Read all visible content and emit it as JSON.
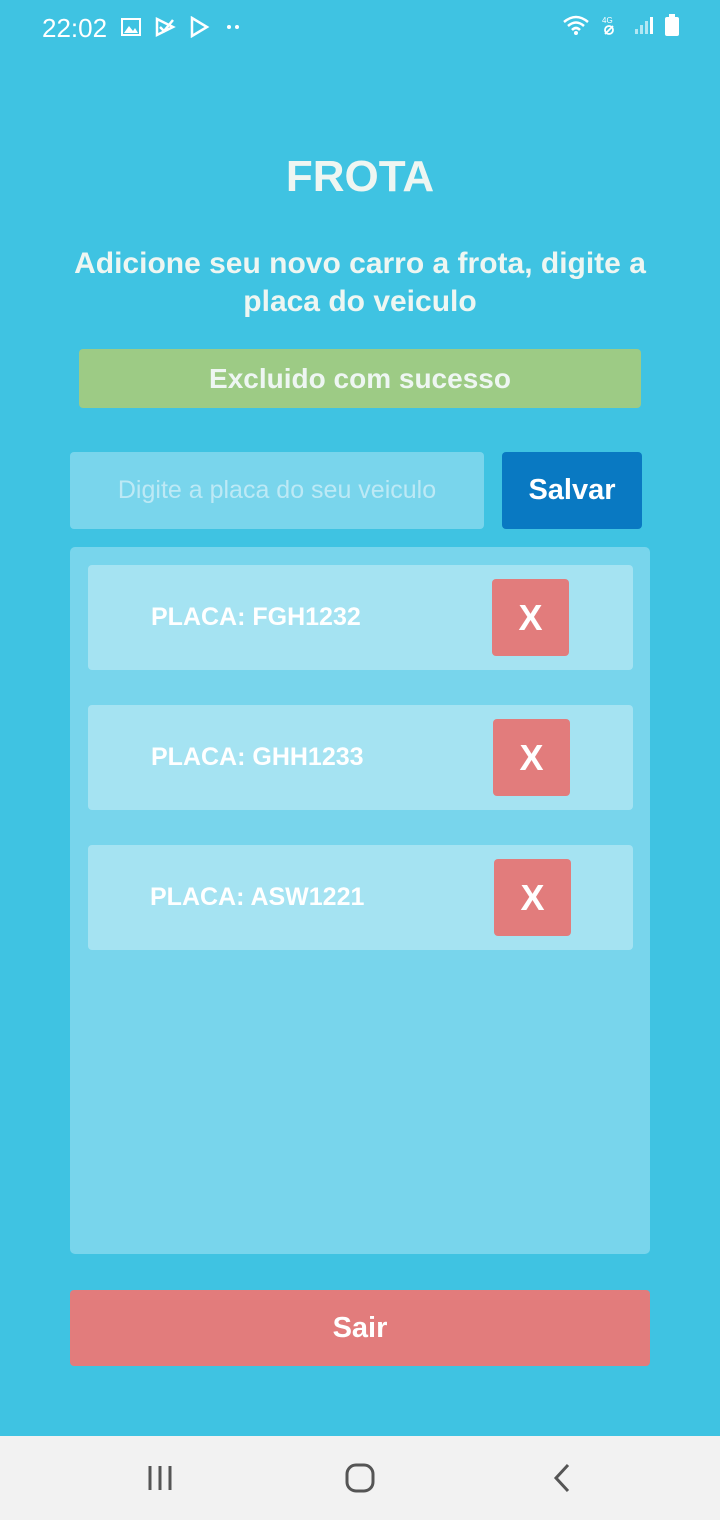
{
  "status_bar": {
    "time": "22:02",
    "left_icons": [
      "image-icon",
      "check-app-icon",
      "play-store-icon",
      "more-dots-icon"
    ],
    "right_icons": [
      "wifi-icon",
      "mobile-data-4g-icon",
      "signal-icon",
      "battery-icon"
    ]
  },
  "header": {
    "title": "FROTA",
    "subtitle": "Adicione seu novo carro a frota, digite a placa do veiculo"
  },
  "toast": {
    "message": "Excluido com sucesso",
    "color": "#9dcb85"
  },
  "form": {
    "plate_placeholder": "Digite a placa do seu veiculo",
    "plate_value": "",
    "save_label": "Salvar"
  },
  "vehicles": [
    {
      "label": "PLACA: FGH1232",
      "delete_label": "X"
    },
    {
      "label": "PLACA: GHH1233",
      "delete_label": "X"
    },
    {
      "label": "PLACA: ASW1221",
      "delete_label": "X"
    }
  ],
  "footer": {
    "exit_label": "Sair"
  },
  "navigation": {
    "buttons": [
      "recent-apps-icon",
      "home-icon",
      "back-icon"
    ]
  },
  "colors": {
    "background": "#3fc3e2",
    "primary_button": "#0979c2",
    "danger": "#e27c7c",
    "panel": "#78d5ec",
    "card": "#a5e3f2"
  }
}
